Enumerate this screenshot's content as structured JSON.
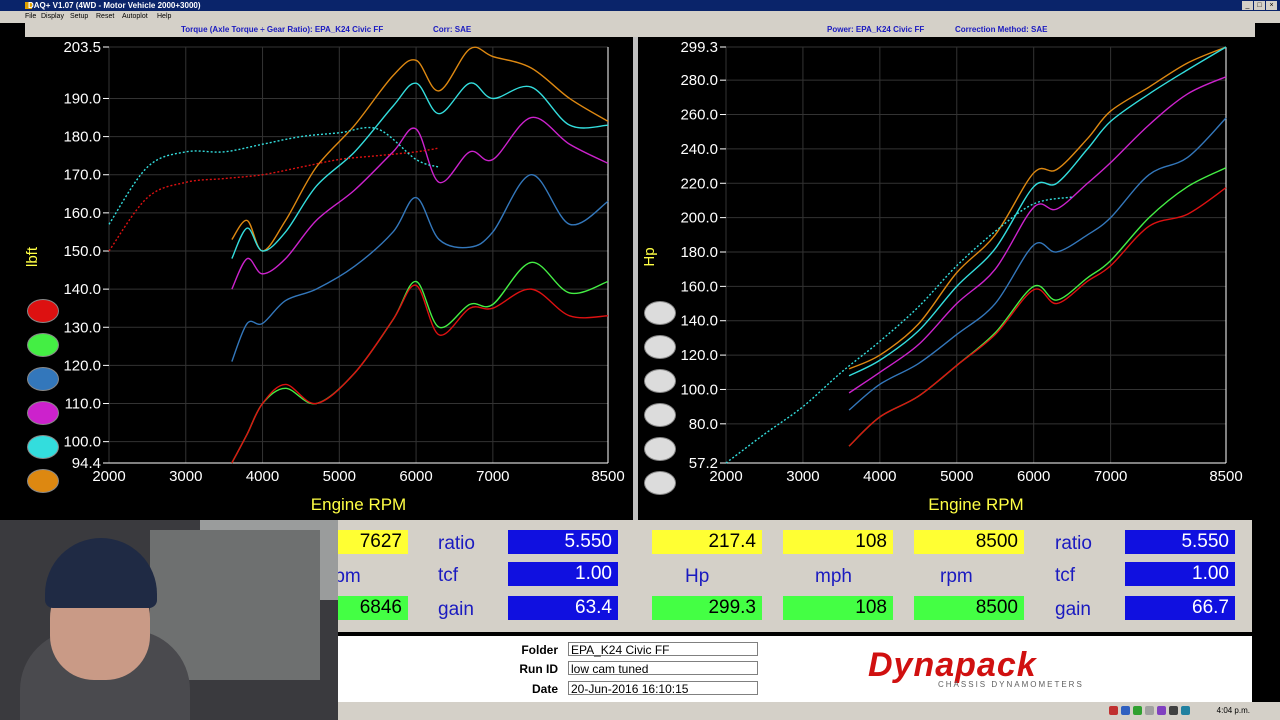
{
  "window": {
    "title": "DAQ+ V1.07 (4WD - Motor Vehicle 2000+3000)",
    "menus": [
      "File",
      "Display",
      "Setup",
      "Reset",
      "Autoplot",
      "Help"
    ]
  },
  "headers": {
    "torque_label": "Torque (Axle Torque ÷ Gear Ratio): EPA_K24 Civic FF",
    "torque_corr": "Corr: SAE",
    "power_label": "Power: EPA_K24 Civic FF",
    "power_corr": "Correction Method: SAE"
  },
  "colors": {
    "red": "#dd1111",
    "green": "#44ee44",
    "blue": "#3377bb",
    "magenta": "#cc22cc",
    "cyan": "#33dddd",
    "orange": "#dd8811",
    "axis_text": "#ffffff",
    "axis_title": "#ffff44"
  },
  "legend_series": [
    "red",
    "green",
    "blue",
    "magenta",
    "cyan",
    "orange"
  ],
  "chart_data": [
    {
      "type": "line",
      "title": "",
      "xlabel": "Engine RPM",
      "ylabel": "lbft",
      "xlim": [
        2000,
        8500
      ],
      "ylim": [
        94.4,
        203.5
      ],
      "x_ticks": [
        "2000",
        "3000",
        "4000",
        "5000",
        "6000",
        "7000",
        "8500"
      ],
      "y_ticks": [
        "203.5",
        "190.0",
        "180.0",
        "170.0",
        "160.0",
        "150.0",
        "140.0",
        "130.0",
        "120.0",
        "110.0",
        "100.0",
        "94.4"
      ],
      "series": [
        {
          "color": "orange",
          "x": [
            3600,
            3800,
            4000,
            4300,
            4700,
            5200,
            5700,
            6000,
            6300,
            6700,
            7000,
            7500,
            8000,
            8500
          ],
          "y": [
            153,
            158,
            150,
            158,
            172,
            183,
            196,
            200,
            192,
            203,
            201,
            198,
            190,
            184
          ]
        },
        {
          "color": "cyan",
          "x": [
            3600,
            3800,
            4000,
            4300,
            4700,
            5200,
            5700,
            6000,
            6300,
            6700,
            7000,
            7500,
            8000,
            8500
          ],
          "y": [
            148,
            156,
            150,
            155,
            167,
            176,
            188,
            194,
            186,
            194,
            190,
            193,
            183,
            183
          ]
        },
        {
          "color": "magenta",
          "x": [
            3600,
            3800,
            4000,
            4300,
            4700,
            5200,
            5700,
            6000,
            6300,
            6700,
            7000,
            7500,
            8000,
            8500
          ],
          "y": [
            140,
            148,
            144,
            148,
            158,
            166,
            176,
            182,
            168,
            176,
            174,
            185,
            178,
            173
          ]
        },
        {
          "color": "blue",
          "x": [
            3600,
            3800,
            4000,
            4300,
            4700,
            5200,
            5700,
            6000,
            6300,
            6700,
            7000,
            7500,
            8000,
            8500
          ],
          "y": [
            121,
            131,
            131,
            137,
            140,
            146,
            155,
            164,
            153,
            151,
            155,
            170,
            157,
            163
          ]
        },
        {
          "color": "green",
          "x": [
            3600,
            3800,
            4000,
            4300,
            4700,
            5200,
            5700,
            6000,
            6300,
            6700,
            7000,
            7500,
            8000,
            8500
          ],
          "y": [
            94.4,
            102,
            110,
            114,
            110,
            118,
            132,
            142,
            130,
            136,
            136,
            147,
            139,
            142
          ]
        },
        {
          "color": "red",
          "x": [
            3600,
            3800,
            4000,
            4300,
            4700,
            5200,
            5700,
            6000,
            6300,
            6700,
            7000,
            7500,
            8000,
            8500
          ],
          "y": [
            94.4,
            102,
            110,
            115,
            110,
            118,
            132,
            141,
            128,
            135,
            135,
            140,
            133,
            133
          ]
        },
        {
          "color": "red",
          "x": [
            2000,
            2500,
            3000,
            3500,
            4000,
            4500,
            5000,
            5500,
            6000,
            6300
          ],
          "y": [
            150,
            164,
            168,
            169,
            170,
            172,
            174,
            175,
            176,
            177
          ]
        },
        {
          "color": "cyan",
          "x": [
            2000,
            2500,
            3000,
            3500,
            4000,
            4500,
            5000,
            5500,
            6000,
            6300
          ],
          "y": [
            157,
            172,
            176,
            176,
            178,
            180,
            181,
            182,
            174,
            172
          ]
        }
      ]
    },
    {
      "type": "line",
      "title": "",
      "xlabel": "Engine RPM",
      "ylabel": "Hp",
      "xlim": [
        2000,
        8500
      ],
      "ylim": [
        57.2,
        299.3
      ],
      "x_ticks": [
        "2000",
        "3000",
        "4000",
        "5000",
        "6000",
        "7000",
        "8500"
      ],
      "y_ticks": [
        "299.3",
        "280.0",
        "260.0",
        "240.0",
        "220.0",
        "200.0",
        "180.0",
        "160.0",
        "140.0",
        "120.0",
        "100.0",
        "80.0",
        "57.2"
      ],
      "series": [
        {
          "color": "orange",
          "x": [
            3600,
            4000,
            4500,
            5000,
            5500,
            6000,
            6300,
            6700,
            7000,
            7500,
            8000,
            8500
          ],
          "y": [
            112,
            120,
            138,
            168,
            190,
            226,
            228,
            246,
            262,
            276,
            290,
            299.3
          ]
        },
        {
          "color": "cyan",
          "x": [
            3600,
            4000,
            4500,
            5000,
            5500,
            6000,
            6300,
            6700,
            7000,
            7500,
            8000,
            8500
          ],
          "y": [
            108,
            117,
            134,
            160,
            182,
            218,
            220,
            240,
            256,
            272,
            286,
            299.3
          ]
        },
        {
          "color": "magenta",
          "x": [
            3600,
            4000,
            4500,
            5000,
            5500,
            6000,
            6300,
            6700,
            7000,
            7500,
            8000,
            8500
          ],
          "y": [
            98,
            110,
            126,
            150,
            170,
            206,
            205,
            220,
            232,
            254,
            272,
            282
          ]
        },
        {
          "color": "blue",
          "x": [
            3600,
            4000,
            4500,
            5000,
            5500,
            6000,
            6300,
            6700,
            7000,
            7500,
            8000,
            8500
          ],
          "y": [
            88,
            103,
            115,
            132,
            150,
            184,
            180,
            190,
            200,
            225,
            235,
            258
          ]
        },
        {
          "color": "green",
          "x": [
            3600,
            4000,
            4500,
            5000,
            5500,
            6000,
            6300,
            6700,
            7000,
            7500,
            8000,
            8500
          ],
          "y": [
            67,
            84,
            96,
            114,
            133,
            160,
            152,
            165,
            175,
            200,
            218,
            229
          ]
        },
        {
          "color": "red",
          "x": [
            3600,
            4000,
            4500,
            5000,
            5500,
            6000,
            6300,
            6700,
            7000,
            7500,
            8000,
            8500
          ],
          "y": [
            67,
            84,
            96,
            114,
            132,
            158,
            150,
            163,
            172,
            195,
            202,
            217.4
          ]
        },
        {
          "color": "cyan",
          "x": [
            2000,
            2500,
            3000,
            3500,
            4000,
            4500,
            5000,
            5500,
            6000,
            6500
          ],
          "y": [
            57.2,
            74,
            90,
            110,
            128,
            148,
            172,
            192,
            208,
            212
          ]
        }
      ]
    }
  ],
  "readouts": {
    "left": {
      "top_value": "7627",
      "mid_label": "rpm",
      "bottom_value": "6846",
      "ratio_label": "ratio",
      "ratio_value": "5.550",
      "tcf_label": "tcf",
      "tcf_value": "1.00",
      "gain_label": "gain",
      "gain_value": "63.4"
    },
    "right": {
      "hp_top": "217.4",
      "mph_top": "108",
      "rpm_top": "8500",
      "hp_label": "Hp",
      "mph_label": "mph",
      "rpm_label": "rpm",
      "hp_bottom": "299.3",
      "mph_bottom": "108",
      "rpm_bottom": "8500",
      "ratio_label": "ratio",
      "ratio_value": "5.550",
      "tcf_label": "tcf",
      "tcf_value": "1.00",
      "gain_label": "gain",
      "gain_value": "66.7"
    }
  },
  "info": {
    "folder_label": "Folder",
    "folder_value": "EPA_K24 Civic FF",
    "runid_label": "Run ID",
    "runid_value": "low cam tuned",
    "date_label": "Date",
    "date_value": "20-Jun-2016 16:10:15",
    "logo_text": "Dynapack",
    "logo_subtext": "CHASSIS DYNAMOMETERS"
  },
  "taskbar": {
    "clock": "4:04 p.m."
  }
}
